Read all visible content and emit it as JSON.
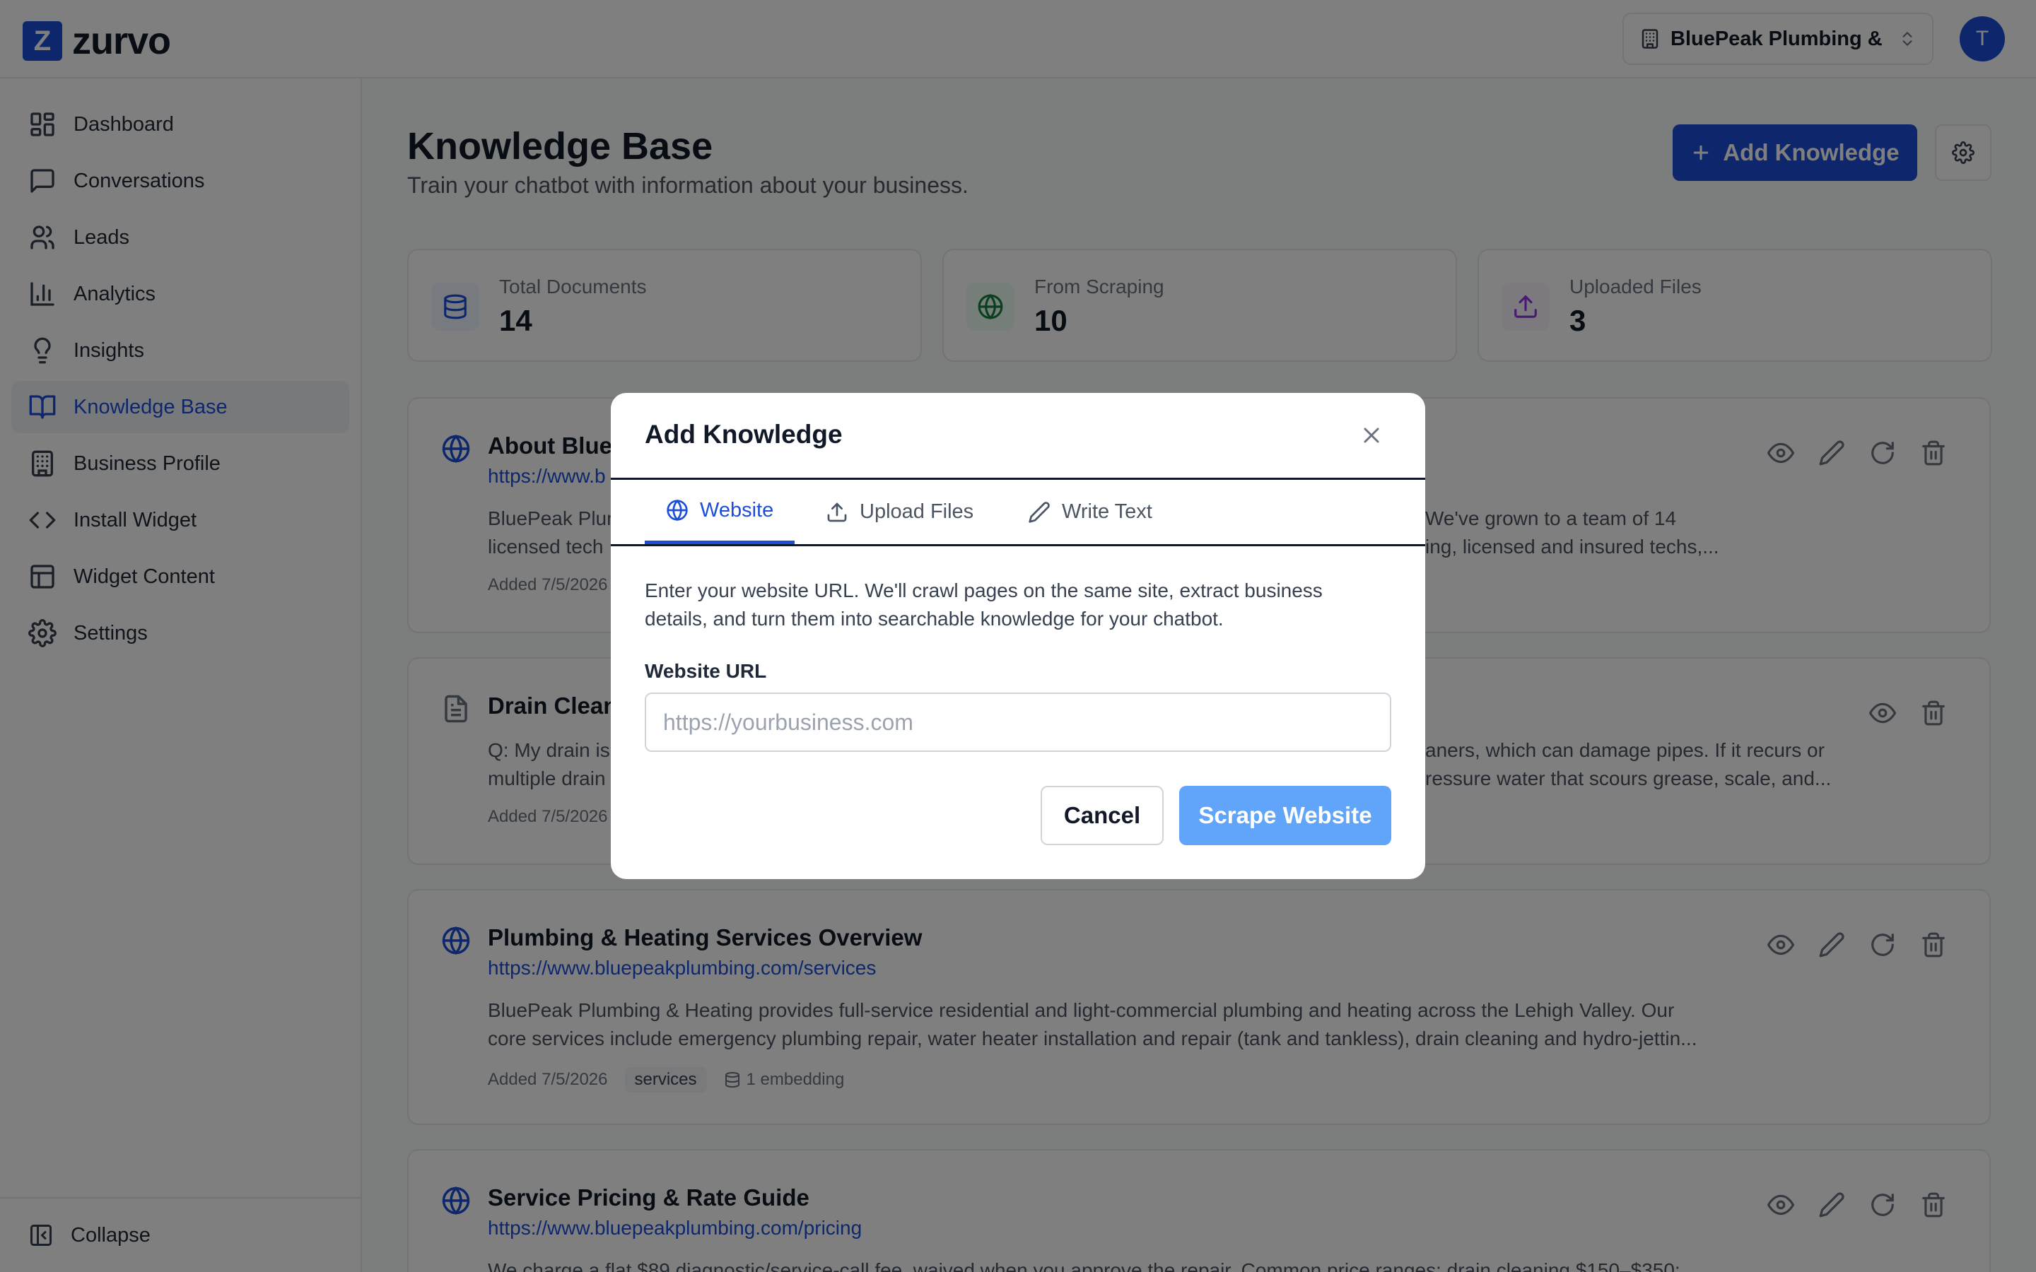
{
  "brand": {
    "logo_letter": "Z",
    "name": "zurvo",
    "accent": "#1d4ed8"
  },
  "header": {
    "business_name": "BluePeak Plumbing & ...",
    "avatar_initial": "T"
  },
  "sidebar": {
    "items": [
      {
        "label": "Dashboard",
        "icon": "dashboard-icon"
      },
      {
        "label": "Conversations",
        "icon": "message-square-icon"
      },
      {
        "label": "Leads",
        "icon": "users-icon"
      },
      {
        "label": "Analytics",
        "icon": "bar-chart-icon"
      },
      {
        "label": "Insights",
        "icon": "lightbulb-icon"
      },
      {
        "label": "Knowledge Base",
        "icon": "book-open-icon",
        "active": true
      },
      {
        "label": "Business Profile",
        "icon": "building-icon"
      },
      {
        "label": "Install Widget",
        "icon": "code-icon"
      },
      {
        "label": "Widget Content",
        "icon": "layout-icon"
      },
      {
        "label": "Settings",
        "icon": "gear-icon"
      }
    ],
    "collapse_label": "Collapse"
  },
  "main": {
    "title": "Knowledge Base",
    "subtitle": "Train your chatbot with information about your business.",
    "add_button": "Add Knowledge",
    "stats": [
      {
        "label": "Total Documents",
        "value": "14",
        "icon": "database-icon"
      },
      {
        "label": "From Scraping",
        "value": "10",
        "icon": "globe-icon"
      },
      {
        "label": "Uploaded Files",
        "value": "3",
        "icon": "upload-icon"
      }
    ],
    "cards": [
      {
        "title": "About BlueP",
        "url": "https://www.b",
        "body_left": "BluePeak Plum",
        "body_left2": "licensed tech",
        "body_right": "We've grown to a team of 14",
        "body_right2": "ing, licensed and insured techs,...",
        "added": "Added 7/5/2026"
      },
      {
        "title": "Drain Clean",
        "body_left": "Q: My drain is",
        "body_left2": "multiple drain",
        "body_right": "aners, which can damage pipes. If it recurs or",
        "body_right2": "ressure water that scours grease, scale, and...",
        "added": "Added 7/5/2026"
      },
      {
        "title": "Plumbing & Heating Services Overview",
        "url": "https://www.bluepeakplumbing.com/services",
        "body1": "BluePeak Plumbing & Heating provides full-service residential and light-commercial plumbing and heating across the Lehigh Valley. Our",
        "body2": "core services include emergency plumbing repair, water heater installation and repair (tank and tankless), drain cleaning and hydro-jettin...",
        "added": "Added 7/5/2026",
        "tag": "services",
        "embeddings": "1 embedding"
      },
      {
        "title": "Service Pricing & Rate Guide",
        "url": "https://www.bluepeakplumbing.com/pricing",
        "body1": "We charge a flat $89 diagnostic/service-call fee, waived when you approve the repair. Common price ranges: drain cleaning $150–$350;"
      }
    ]
  },
  "modal": {
    "title": "Add Knowledge",
    "tabs": [
      "Website",
      "Upload Files",
      "Write Text"
    ],
    "active_tab": "Website",
    "description": "Enter your website URL. We'll crawl pages on the same site, extract business details, and turn them into searchable knowledge for your chatbot.",
    "field_label": "Website URL",
    "input_placeholder": "https://yourbusiness.com",
    "input_value": "",
    "cancel_label": "Cancel",
    "submit_label": "Scrape Website"
  }
}
